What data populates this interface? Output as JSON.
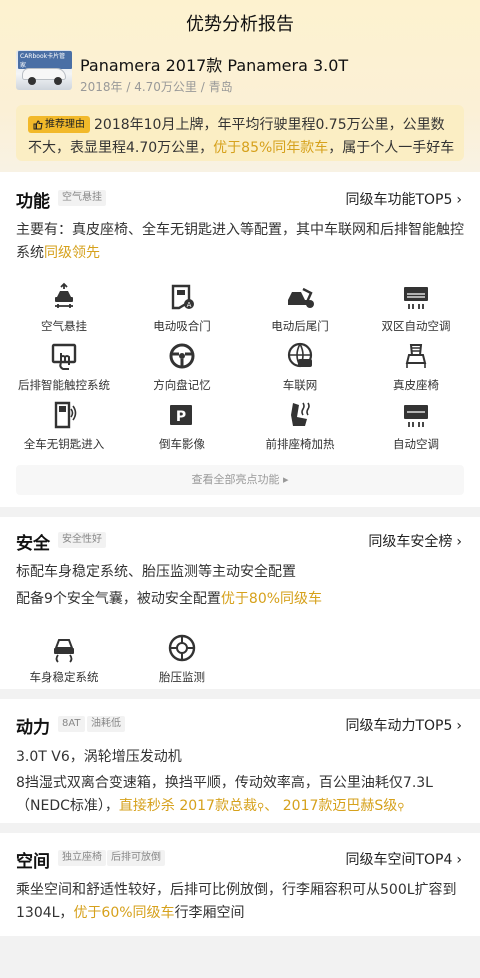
{
  "header": {
    "title": "优势分析报告"
  },
  "car": {
    "thumb_tag": "CARbook卡片管家",
    "title": "Panamera 2017款 Panamera 3.0T",
    "meta": "2018年 / 4.70万公里 / 青岛"
  },
  "reason": {
    "badge": "推荐理由",
    "text_1": "2018年10月上牌，年平均行驶里程0.75万公里，公里数不大，表显里程4.70万公里，",
    "text_hl": "优于85%同年款车",
    "text_2": "，属于个人一手好车"
  },
  "features": {
    "title": "功能",
    "tag": "空气悬挂",
    "rank_label": "同级车功能TOP5",
    "desc_1": "主要有：真皮座椅、全车无钥匙进入等配置，其中车联网和后排智能触控系统",
    "desc_hl": "同级领先",
    "items": [
      {
        "label": "空气悬挂",
        "icon": "air-suspension-icon"
      },
      {
        "label": "电动吸合门",
        "icon": "soft-close-door-icon"
      },
      {
        "label": "电动后尾门",
        "icon": "power-tailgate-icon"
      },
      {
        "label": "双区自动空调",
        "icon": "dual-zone-ac-icon"
      },
      {
        "label": "后排智能触控系统",
        "icon": "rear-touch-icon"
      },
      {
        "label": "方向盘记忆",
        "icon": "steering-memory-icon"
      },
      {
        "label": "车联网",
        "icon": "connected-car-icon"
      },
      {
        "label": "真皮座椅",
        "icon": "leather-seat-icon"
      },
      {
        "label": "全车无钥匙进入",
        "icon": "keyless-entry-icon"
      },
      {
        "label": "倒车影像",
        "icon": "reverse-camera-icon"
      },
      {
        "label": "前排座椅加热",
        "icon": "seat-heating-icon"
      },
      {
        "label": "自动空调",
        "icon": "auto-ac-icon"
      }
    ],
    "view_all": "查看全部亮点功能"
  },
  "safety": {
    "title": "安全",
    "tag": "安全性好",
    "rank_label": "同级车安全榜",
    "line1": "标配车身稳定系统、胎压监测等主动安全配置",
    "line2_pre": "配备9个安全气囊，被动安全配置",
    "line2_hl": "优于80%同级车",
    "items": [
      {
        "label": "车身稳定系统",
        "icon": "stability-control-icon"
      },
      {
        "label": "胎压监测",
        "icon": "tire-pressure-icon"
      }
    ]
  },
  "power": {
    "title": "动力",
    "tags": [
      "8AT",
      "油耗低"
    ],
    "rank_label": "同级车动力TOP5",
    "line1": "3.0T V6，涡轮增压发动机",
    "line2": "8挡湿式双离合变速箱，换挡平顺，传动效率高，百公里油耗仅7.3L（NEDC标准），",
    "line2_hl": "直接秒杀 2017款总裁",
    "line2_sep": "、",
    "line2_hl2": "2017款迈巴赫S级"
  },
  "space": {
    "title": "空间",
    "tags": [
      "独立座椅",
      "后排可放倒"
    ],
    "rank_label": "同级车空间TOP4",
    "desc_1": "乘坐空间和舒适性较好，后排可比例放倒，行李厢容积可从500L扩容到1304L，",
    "desc_hl": "优于60%同级车",
    "desc_2": "行李厢空间"
  },
  "colors": {
    "accent": "#d6a11c",
    "badge": "#f2b92a",
    "bg_top": "#fdf2cf"
  }
}
